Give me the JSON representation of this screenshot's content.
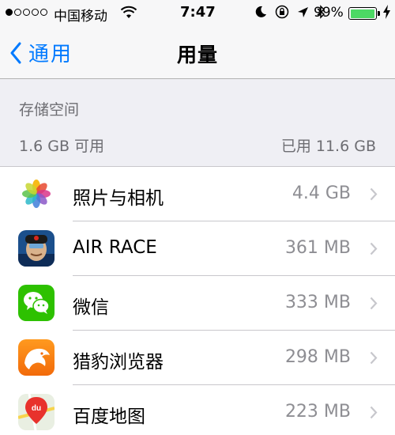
{
  "status_bar": {
    "carrier": "中国移动",
    "time": "7:47",
    "battery_percent": "99%",
    "battery_level": 0.99,
    "battery_color": "#4cd964"
  },
  "nav": {
    "back_label": "通用",
    "title": "用量",
    "accent_color": "#007aff"
  },
  "storage": {
    "header": "存储空间",
    "available": "1.6 GB 可用",
    "used": "已用 11.6 GB"
  },
  "apps": [
    {
      "name": "照片与相机",
      "size": "4.4 GB",
      "icon": "photos-icon"
    },
    {
      "name": "AIR RACE",
      "size": "361 MB",
      "icon": "air-race-icon"
    },
    {
      "name": "微信",
      "size": "333 MB",
      "icon": "wechat-icon"
    },
    {
      "name": "猎豹浏览器",
      "size": "298 MB",
      "icon": "cheetah-browser-icon"
    },
    {
      "name": "百度地图",
      "size": "223 MB",
      "icon": "baidu-map-icon"
    }
  ]
}
